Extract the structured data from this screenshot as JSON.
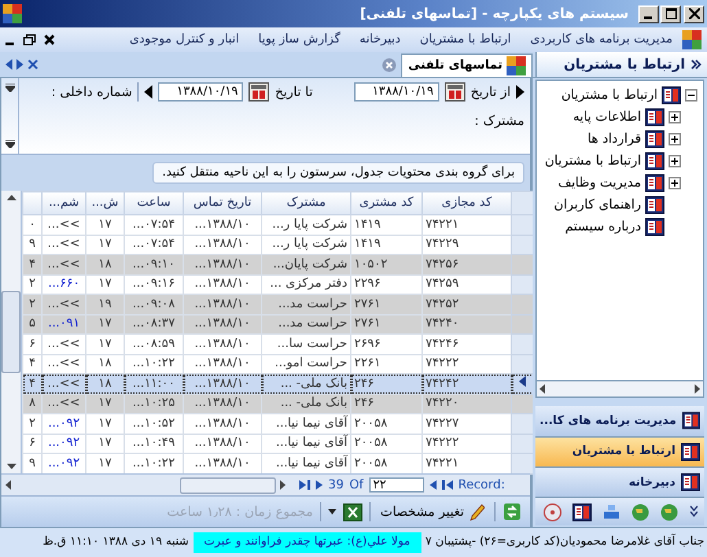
{
  "window": {
    "title": "سیستم های یکپارچه - [تماسهای تلفنی]"
  },
  "menu": {
    "items": [
      "مدیریت برنامه های کاربردی",
      "ارتباط با مشتریان",
      "دبیرخانه",
      "گزارش ساز پویا",
      "انبار و کنترل موجودی"
    ]
  },
  "side_panel": {
    "title": "ارتباط با مشتریان",
    "tree": [
      {
        "label": "ارتباط با مشتریان",
        "expanded": true,
        "children": [
          {
            "label": "اطلاعات پایه",
            "expanded": false
          },
          {
            "label": "قرارداد ها",
            "expanded": false
          },
          {
            "label": "ارتباط با مشتریان",
            "expanded": false
          },
          {
            "label": "مدیریت وظایف",
            "expanded": false
          },
          {
            "label": "راهنمای کاربران"
          },
          {
            "label": "درباره سیستم"
          }
        ]
      }
    ]
  },
  "nav_buttons": [
    {
      "label": "مدیریت برنامه های کا...",
      "selected": false
    },
    {
      "label": "ارتباط با مشتریان",
      "selected": true
    },
    {
      "label": "دبیرخانه",
      "selected": false
    }
  ],
  "document_tabs": [
    {
      "label": "تماسهای تلفنی",
      "selected": true
    }
  ],
  "filters": {
    "from_label": "از تاریخ",
    "from_value": "۱۳۸۸/۱۰/۱۹",
    "to_label": "تا تاریخ",
    "to_value": "۱۳۸۸/۱۰/۱۹",
    "extension_label": "شماره داخلی :",
    "subscriber_label": "مشترک :"
  },
  "group_panel": {
    "hint": "برای گروه بندی محتویات جدول، سرستون را به این ناحیه منتقل کنید."
  },
  "table": {
    "columns": [
      "کد مجازی",
      "کد مشتری",
      "مشترک",
      "تاریخ تماس",
      "ساعت",
      "ش...",
      "شم..."
    ],
    "rows": [
      {
        "cells": [
          "۷۴۲۲۱",
          "۱۴۱۹",
          "شرکت پایا ر...",
          "...۱۳۸۸/۱۰",
          "...۰۷:۵۴",
          "۱۷",
          "...<<",
          "۰"
        ],
        "selected": false,
        "highlighted": false,
        "linked": false
      },
      {
        "cells": [
          "۷۴۲۲۹",
          "۱۴۱۹",
          "شرکت پایا ر...",
          "...۱۳۸۸/۱۰",
          "...۰۷:۵۴",
          "۱۷",
          "...<<",
          "۹"
        ],
        "selected": false,
        "highlighted": false,
        "linked": false
      },
      {
        "cells": [
          "۷۴۲۵۶",
          "۱۰۵۰۲",
          "شرکت پایان...",
          "...۱۳۸۸/۱۰",
          "...۰۹:۱۰",
          "۱۸",
          "...<<",
          "۴"
        ],
        "selected": false,
        "highlighted": true,
        "linked": false
      },
      {
        "cells": [
          "۷۴۲۵۹",
          "۲۲۹۶",
          "دفتر مرکزی ...",
          "...۱۳۸۸/۱۰",
          "...۰۹:۱۶",
          "۱۷",
          "...۶۶۰",
          "۲"
        ],
        "selected": false,
        "highlighted": false,
        "linked": true
      },
      {
        "cells": [
          "۷۴۲۵۲",
          "۲۷۶۱",
          "حراست مد...",
          "...۱۳۸۸/۱۰",
          "...۰۹:۰۸",
          "۱۹",
          "...<<",
          "۲"
        ],
        "selected": false,
        "highlighted": true,
        "linked": false
      },
      {
        "cells": [
          "۷۴۲۴۰",
          "۲۷۶۱",
          "حراست مد...",
          "...۱۳۸۸/۱۰",
          "...۰۸:۳۷",
          "۱۷",
          "...۰۹۱",
          "۵"
        ],
        "selected": false,
        "highlighted": true,
        "linked": true
      },
      {
        "cells": [
          "۷۴۲۴۶",
          "۲۶۹۶",
          "حراست سا...",
          "...۱۳۸۸/۱۰",
          "...۰۸:۵۹",
          "۱۷",
          "...<<",
          "۶"
        ],
        "selected": false,
        "highlighted": false,
        "linked": false
      },
      {
        "cells": [
          "۷۴۲۲۲",
          "۲۲۶۱",
          "حراست امو...",
          "...۱۳۸۸/۱۰",
          "...۱۰:۲۲",
          "۱۸",
          "...<<",
          "۴"
        ],
        "selected": false,
        "highlighted": false,
        "linked": false
      },
      {
        "cells": [
          "۷۴۲۴۲",
          "۲۴۶",
          "بانک ملی- ...",
          "...۱۳۸۸/۱۰",
          "...۱۱:۰۰",
          "۱۸",
          "...<<",
          "۴"
        ],
        "selected": true,
        "highlighted": false,
        "linked": false
      },
      {
        "cells": [
          "۷۴۲۲۰",
          "۲۴۶",
          "بانک ملی- ...",
          "...۱۳۸۸/۱۰",
          "...۱۰:۲۵",
          "۱۷",
          "...<<",
          "۸"
        ],
        "selected": false,
        "highlighted": true,
        "linked": false
      },
      {
        "cells": [
          "۷۴۲۲۷",
          "۲۰۰۵۸",
          "آقای نیما نیا...",
          "...۱۳۸۸/۱۰",
          "...۱۰:۵۲",
          "۱۷",
          "...۰۹۲",
          "۲"
        ],
        "selected": false,
        "highlighted": false,
        "linked": true
      },
      {
        "cells": [
          "۷۴۲۲۲",
          "۲۰۰۵۸",
          "آقای نیما نیا...",
          "...۱۳۸۸/۱۰",
          "...۱۰:۴۹",
          "۱۷",
          "...۰۹۲",
          "۶"
        ],
        "selected": false,
        "highlighted": false,
        "linked": true
      },
      {
        "cells": [
          "۷۴۲۲۱",
          "۲۰۰۵۸",
          "آقای نیما نیا...",
          "...۱۳۸۸/۱۰",
          "...۱۰:۲۲",
          "۱۷",
          "...۰۹۲",
          "۹"
        ],
        "selected": false,
        "highlighted": false,
        "linked": true
      }
    ]
  },
  "pager": {
    "label": "Record:",
    "current": "۲۲",
    "of": "Of",
    "total": "39"
  },
  "toolbar": {
    "edit_button": "تغییر مشخصات",
    "total_time": "مجموع زمان : ۱٫۲۸ ساعت"
  },
  "status_bar": {
    "user": "جناب آقای غلامرضا محمودیان(کد کاربری=۲۶) -پشتیبان ۷",
    "quote": "مولا علي(ع): عبرتها چقدر فراوانند و عبرت",
    "datetime": "شنبه ۱۹ دی ۱۳۸۸ ۱۱:۱۰ ق.ظ"
  }
}
